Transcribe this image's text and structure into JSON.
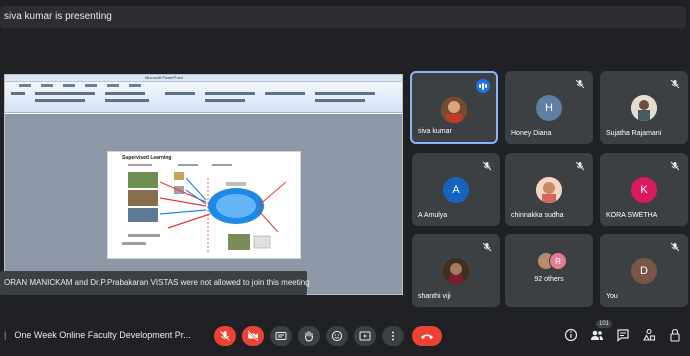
{
  "header": {
    "presenting_text": "siva kumar is presenting"
  },
  "shared_screen": {
    "window_title": "Microsoft PowerPoint",
    "slide_title": "Supervised Learning"
  },
  "toast": {
    "message": "ORAN MANICKAM and Dr.P.Prabakaran VISTAS were not allowed to join this meeting"
  },
  "participants": [
    {
      "name": "siva kumar",
      "initial": "",
      "color": "#8b5a3c",
      "muted": false,
      "speaking": true
    },
    {
      "name": "Honey Diana",
      "initial": "H",
      "color": "#5f7fa3",
      "muted": true
    },
    {
      "name": "Sujatha Rajamani",
      "initial": "",
      "color": "#d9d0c4",
      "muted": true
    },
    {
      "name": "A Amulya",
      "initial": "A",
      "color": "#1565c0",
      "muted": true
    },
    {
      "name": "chinnakka sudha",
      "initial": "",
      "color": "#e2a48c",
      "muted": true
    },
    {
      "name": "KORA SWETHA",
      "initial": "K",
      "color": "#d81b60",
      "muted": true
    },
    {
      "name": "shanthi viji",
      "initial": "",
      "color": "#5a4636",
      "muted": true
    },
    {
      "name": "You",
      "initial": "D",
      "color": "#795548",
      "muted": true
    }
  ],
  "others": {
    "label": "92 others",
    "avatar_initial": "R"
  },
  "bottom_bar": {
    "meeting_title": "One Week Online Faculty Development Pr...",
    "participants_count": "101"
  },
  "colors": {
    "danger": "#ea4335",
    "accent": "#8ab4f8",
    "tile": "#3c4043",
    "background": "#202124"
  }
}
